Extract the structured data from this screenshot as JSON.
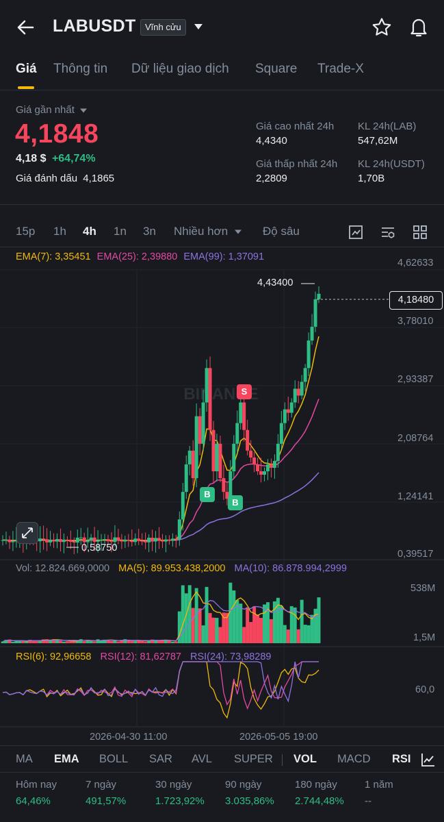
{
  "header": {
    "title": "LABUSDT",
    "badge": "Vĩnh cửu",
    "icons": [
      "back-arrow-icon",
      "chevron-down-icon",
      "star-icon",
      "bell-icon"
    ]
  },
  "tabs": [
    {
      "label": "Giá",
      "active": true
    },
    {
      "label": "Thông tin"
    },
    {
      "label": "Dữ liệu giao dịch"
    },
    {
      "label": "Square"
    },
    {
      "label": "Trade-X"
    }
  ],
  "price": {
    "last_label": "Giá gần nhất",
    "last": "4,1848",
    "usd": "4,18 $",
    "change": "+64,74%",
    "mark_label": "Giá đánh dấu",
    "mark": "4,1865"
  },
  "stats": {
    "high_label": "Giá cao nhất 24h",
    "high": "4,4340",
    "low_label": "Giá thấp nhất 24h",
    "low": "2,2809",
    "vol_lab_label": "KL 24h(LAB)",
    "vol_lab": "547,62M",
    "vol_usdt_label": "KL 24h(USDT)",
    "vol_usdt": "1,70B"
  },
  "timeframes": [
    "15p",
    "1h",
    "4h",
    "1n",
    "3n",
    "Nhiều hơn",
    "Độ sâu"
  ],
  "timeframe_active": "4h",
  "colors": {
    "up": "#2ebd85",
    "down": "#f6465d",
    "accent": "#f0b90b",
    "ema7": "#f0b90b",
    "ema25": "#e349a4",
    "ema99": "#8d73e0",
    "bg": "#181a20"
  },
  "chart": {
    "ema_legend": {
      "ema7": "EMA(7): 3,35451",
      "ema25": "EMA(25): 2,39880",
      "ema99": "EMA(99): 1,37091"
    },
    "y_ticks": [
      "4,62633",
      "3,78010",
      "2,93387",
      "2,08764",
      "1,24141",
      "0,39517"
    ],
    "high_label": "4,43400",
    "low_label": "0,58750",
    "current_price": "4,18480",
    "markers": {
      "buy": "B",
      "sell": "S"
    },
    "watermark": "BINANCE",
    "vol_legend": {
      "vol": "Vol: 12.824.669,0000",
      "ma5": "MA(5): 89.953.438,2000",
      "ma10": "MA(10): 86.878.994,2999"
    },
    "vol_ticks": [
      "538M",
      "1,5M"
    ],
    "rsi_legend": {
      "rsi6": "RSI(6): 92,96658",
      "rsi12": "RSI(12): 81,62787",
      "rsi24": "RSI(24): 73,98289"
    },
    "rsi_tick": "60,0",
    "x_ticks": [
      "2026-04-30 11:00",
      "2026-05-05 19:00"
    ]
  },
  "indicators": [
    "MA",
    "EMA",
    "BOLL",
    "SAR",
    "AVL",
    "SUPER",
    "VOL",
    "MACD",
    "RSI"
  ],
  "indicators_active": [
    "EMA",
    "VOL",
    "RSI"
  ],
  "performance": [
    {
      "label": "Hôm nay",
      "value": "64,46%"
    },
    {
      "label": "7 ngày",
      "value": "491,57%"
    },
    {
      "label": "30 ngày",
      "value": "1.723,92%"
    },
    {
      "label": "90 ngày",
      "value": "3.035,86%"
    },
    {
      "label": "180 ngày",
      "value": "2.744,48%"
    },
    {
      "label": "1 năm",
      "value": "--"
    }
  ]
}
